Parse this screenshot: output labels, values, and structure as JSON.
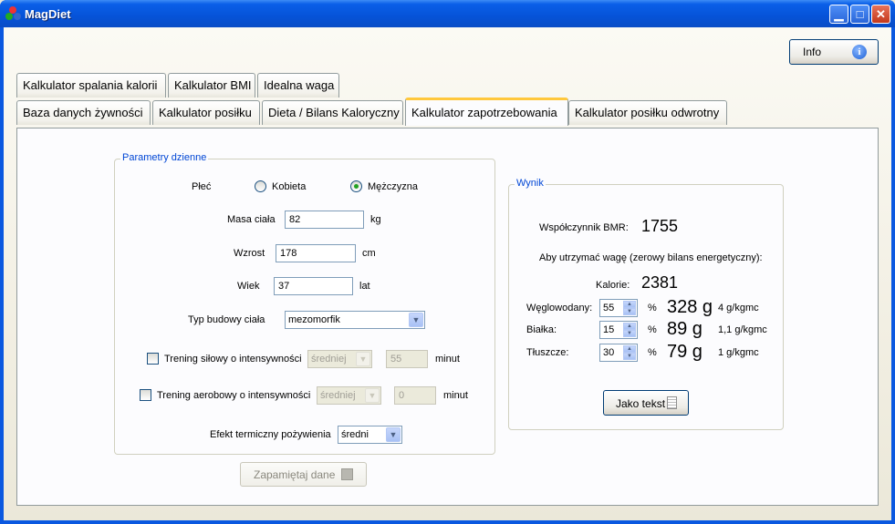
{
  "window": {
    "title": "MagDiet"
  },
  "header": {
    "info_label": "Info"
  },
  "tabs_row1": [
    {
      "label": "Kalkulator spalania kalorii"
    },
    {
      "label": "Kalkulator BMI"
    },
    {
      "label": "Idealna waga"
    }
  ],
  "tabs_row2": [
    {
      "label": "Baza danych żywności"
    },
    {
      "label": "Kalkulator posiłku"
    },
    {
      "label": "Dieta / Bilans Kaloryczny"
    },
    {
      "label": "Kalkulator zapotrzebowania"
    },
    {
      "label": "Kalkulator posiłku odwrotny"
    }
  ],
  "params": {
    "title": "Parametry dzienne",
    "sex_label": "Płeć",
    "sex_female": "Kobieta",
    "sex_male": "Mężczyzna",
    "mass_label": "Masa ciała",
    "mass_value": "82",
    "mass_unit": "kg",
    "height_label": "Wzrost",
    "height_value": "178",
    "height_unit": "cm",
    "age_label": "Wiek",
    "age_value": "37",
    "age_unit": "lat",
    "body_type_label": "Typ budowy ciała",
    "body_type_value": "mezomorfik",
    "strength_label": "Trening siłowy o intensywności",
    "strength_intensity": "średniej",
    "strength_minutes": "55",
    "strength_unit": "minut",
    "aerobic_label": "Trening aerobowy o intensywności",
    "aerobic_intensity": "średniej",
    "aerobic_minutes": "0",
    "aerobic_unit": "minut",
    "thermic_label": "Efekt termiczny pożywienia",
    "thermic_value": "średni",
    "save_label": "Zapamiętaj dane"
  },
  "result": {
    "title": "Wynik",
    "bmr_label": "Współczynnik BMR:",
    "bmr_value": "1755",
    "maintain_text": "Aby utrzymać wagę (zerowy bilans energetyczny):",
    "calories_label": "Kalorie:",
    "calories_value": "2381",
    "carbs_label": "Węglowodany:",
    "carbs_pct": "55",
    "carbs_grams": "328 g",
    "carbs_per_kg": "4 g/kgmc",
    "protein_label": "Białka:",
    "protein_pct": "15",
    "protein_grams": "89 g",
    "protein_per_kg": "1,1 g/kgmc",
    "fat_label": "Tłuszcze:",
    "fat_pct": "30",
    "fat_grams": "79 g",
    "fat_per_kg": "1 g/kgmc",
    "percent_sign": "%",
    "as_text_label": "Jako tekst"
  },
  "colors": {
    "accent": "#0046d5",
    "active_tab": "#ffc83c",
    "titlebar": "#0653d8"
  }
}
